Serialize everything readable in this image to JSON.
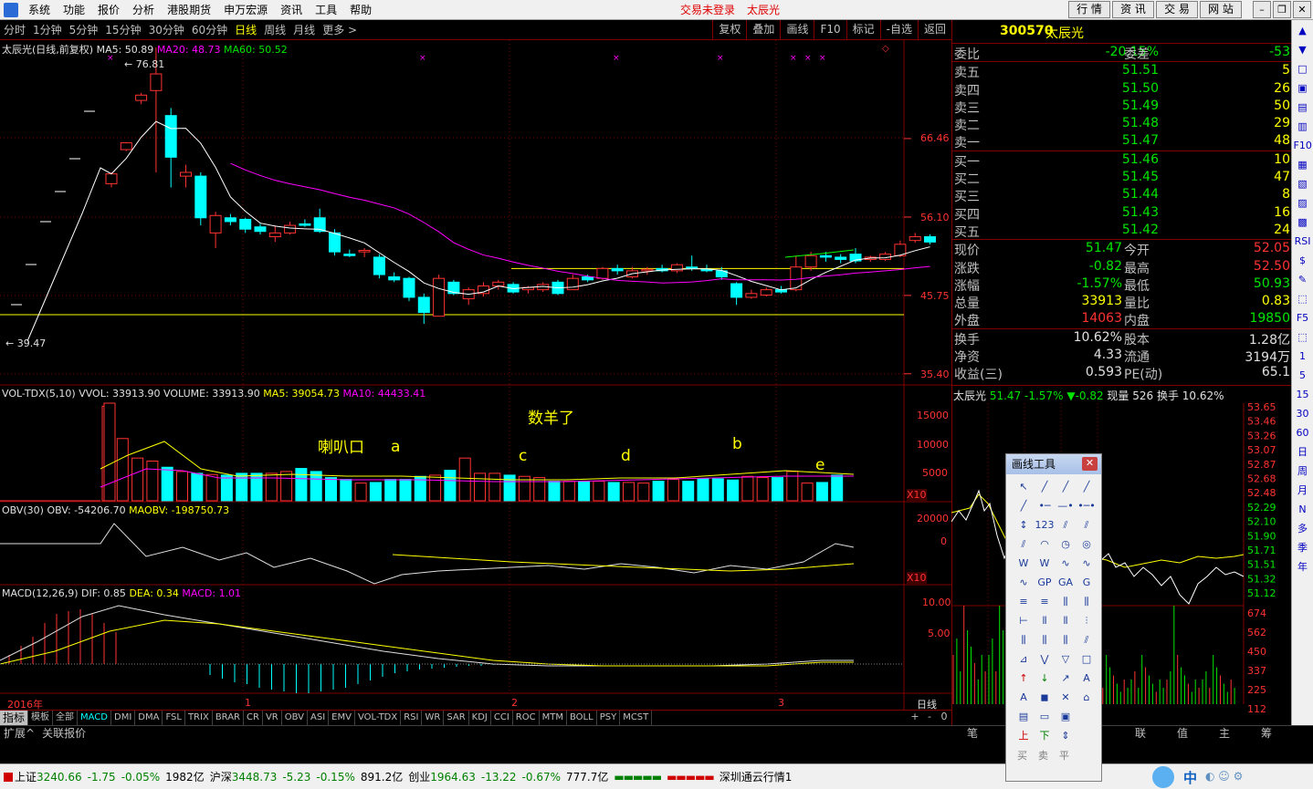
{
  "menu": {
    "items": [
      "系统",
      "功能",
      "报价",
      "分析",
      "港股期货",
      "申万宏源",
      "资讯",
      "工具",
      "帮助"
    ],
    "login_status": "交易未登录",
    "stock_name": "太辰光",
    "top_tabs": [
      "行 情",
      "资 讯",
      "交 易",
      "网 站"
    ]
  },
  "periods": {
    "items": [
      "分时",
      "1分钟",
      "5分钟",
      "15分钟",
      "30分钟",
      "60分钟",
      "日线",
      "周线",
      "月线",
      "更多 >"
    ],
    "active": "日线",
    "tools": [
      "复权",
      "叠加",
      "画线",
      "F10",
      "标记",
      "-自选",
      "返回"
    ]
  },
  "main_chart": {
    "title": "太辰光(日线,前复权)",
    "ma5_label": "MA5: 50.89",
    "ma20_label": "MA20: 48.73",
    "ma60_label": "MA60: 50.52",
    "high_mark": "76.81",
    "low_mark": "39.47",
    "axis_labels": [
      "66.46",
      "56.10",
      "45.75",
      "35.40"
    ]
  },
  "vol_chart": {
    "label_a": "VOL-TDX(5,10)",
    "label_b": "VVOL: 33913.90",
    "label_c": "VOLUME: 33913.90",
    "label_d": "MA5: 39054.73",
    "label_e": "MA10: 44433.41",
    "axis_labels": [
      "15000",
      "10000",
      "5000"
    ],
    "multiplier": "X10"
  },
  "obv_chart": {
    "label_a": "OBV(30)",
    "label_b": "OBV: -54206.70",
    "label_c": "MAOBV: -198750.73",
    "axis_labels": [
      "20000",
      "0"
    ],
    "multiplier": "X10"
  },
  "macd_chart": {
    "label_a": "MACD(12,26,9)",
    "label_b": "DIF: 0.85",
    "label_c": "DEA: 0.34",
    "label_d": "MACD: 1.01",
    "axis_labels": [
      "10.00",
      "5.00"
    ]
  },
  "date_axis": {
    "year": "2016年",
    "months": [
      "1",
      "2",
      "3"
    ],
    "period_label": "日线"
  },
  "annotations": {
    "trumpet": "喇叭口",
    "a": "a",
    "c": "c",
    "d": "d",
    "b": "b",
    "e": "e",
    "note": "数羊了"
  },
  "quote": {
    "code": "300570",
    "name": "太辰光",
    "weibi_label": "委比",
    "weibi": "-20.15%",
    "weicha_label": "委差",
    "weicha": "-53",
    "asks": [
      {
        "label": "卖五",
        "price": "51.51",
        "vol": "5"
      },
      {
        "label": "卖四",
        "price": "51.50",
        "vol": "26"
      },
      {
        "label": "卖三",
        "price": "51.49",
        "vol": "50"
      },
      {
        "label": "卖二",
        "price": "51.48",
        "vol": "29"
      },
      {
        "label": "卖一",
        "price": "51.47",
        "vol": "48"
      }
    ],
    "bids": [
      {
        "label": "买一",
        "price": "51.46",
        "vol": "10"
      },
      {
        "label": "买二",
        "price": "51.45",
        "vol": "47"
      },
      {
        "label": "买三",
        "price": "51.44",
        "vol": "8"
      },
      {
        "label": "买四",
        "price": "51.43",
        "vol": "16"
      },
      {
        "label": "买五",
        "price": "51.42",
        "vol": "24"
      }
    ],
    "stats1": [
      {
        "l1": "现价",
        "v1": "51.47",
        "l2": "今开",
        "v2": "52.05"
      },
      {
        "l1": "涨跌",
        "v1": "-0.82",
        "l2": "最高",
        "v2": "52.50"
      },
      {
        "l1": "涨幅",
        "v1": "-1.57%",
        "l2": "最低",
        "v2": "50.93"
      },
      {
        "l1": "总量",
        "v1": "33913",
        "l2": "量比",
        "v2": "0.83"
      },
      {
        "l1": "外盘",
        "v1": "14063",
        "l2": "内盘",
        "v2": "19850"
      }
    ],
    "stats2": [
      {
        "l1": "换手",
        "v1": "10.62%",
        "l2": "股本",
        "v2": "1.28亿"
      },
      {
        "l1": "净资",
        "v1": "4.33",
        "l2": "流通",
        "v2": "3194万"
      },
      {
        "l1": "收益(三)",
        "v1": "0.593",
        "l2": "PE(动)",
        "v2": "65.1"
      }
    ]
  },
  "mini": {
    "name": "太辰光",
    "price": "51.47",
    "pct": "-1.57%",
    "chg": "▼-0.82",
    "cur_vol": "现量 526",
    "turnover": "换手 10.62%",
    "left_axis": [
      "53.65",
      "53.46",
      "53.26",
      "53.07",
      "52.87",
      "52.68",
      "52.48",
      "52.29",
      "52.10",
      "51.90",
      "51.71",
      "51.51",
      "51.32",
      "51.12",
      "674",
      "562",
      "450",
      "337",
      "225",
      "112"
    ]
  },
  "indicator_tabs": [
    "指标",
    "模板",
    "全部",
    "MACD",
    "DMI",
    "DMA",
    "FSL",
    "TRIX",
    "BRAR",
    "CR",
    "VR",
    "OBV",
    "ASI",
    "EMV",
    "VOL-TDX",
    "RSI",
    "WR",
    "SAR",
    "KDJ",
    "CCI",
    "ROC",
    "MTM",
    "BOLL",
    "PSY",
    "MCST"
  ],
  "sub_tabs": [
    "扩展^",
    "关联报价"
  ],
  "right_tabs": [
    "笔",
    "",
    "",
    "",
    "联",
    "值",
    "主",
    "筹"
  ],
  "draw_tool": {
    "title": "画线工具",
    "bottom": [
      "买",
      "卖",
      "平"
    ]
  },
  "icon_strip": [
    "▲",
    "▼",
    "□",
    "▣",
    "▤",
    "▥",
    "F10",
    "▦",
    "▧",
    "▨",
    "▩",
    "RSI",
    "$",
    "✎",
    "⬚",
    "F5",
    "⬚",
    "1",
    "5",
    "15",
    "30",
    "60",
    "日",
    "周",
    "月",
    "N",
    "多",
    "季",
    "年"
  ],
  "status": {
    "sh_label": "上证",
    "sh_val": "3240.66",
    "sh_chg": "-1.75",
    "sh_pct": "-0.05%",
    "sh_amt": "1982亿",
    "hs_label": "沪深",
    "hs_val": "3448.73",
    "hs_chg": "-5.23",
    "hs_pct": "-0.15%",
    "hs_amt": "891.2亿",
    "cy_label": "创业",
    "cy_val": "1964.63",
    "cy_chg": "-13.22",
    "cy_pct": "-0.67%",
    "cy_amt": "777.7亿",
    "sz_tong": "深圳通云行情1",
    "cn": "中"
  },
  "colors": {
    "up": "#ff3232",
    "down": "#00ffff",
    "ma5": "#ffffff",
    "ma20": "#ff00ff",
    "ma60": "#00ff00",
    "yellow": "#ffff00",
    "border": "#800000"
  },
  "chart_data": {
    "type": "candlestick",
    "candles": [
      [
        60.5,
        62.0,
        60.0,
        61.8
      ],
      [
        65.0,
        66.0,
        64.8,
        65.9
      ],
      [
        71.5,
        72.5,
        71.0,
        72.2
      ],
      [
        72.8,
        78.5,
        62.0,
        75.0
      ],
      [
        69.5,
        70.5,
        60.0,
        64.0
      ],
      [
        61.5,
        63.0,
        60.0,
        62.0
      ],
      [
        61.5,
        62.0,
        55.0,
        56.0
      ],
      [
        54.0,
        56.8,
        52.0,
        56.3
      ],
      [
        56.0,
        56.5,
        55.0,
        55.5
      ],
      [
        55.8,
        56.0,
        54.0,
        54.5
      ],
      [
        54.8,
        55.2,
        53.8,
        54.2
      ],
      [
        53.5,
        55.0,
        52.8,
        54.0
      ],
      [
        54.0,
        55.5,
        53.8,
        55.0
      ],
      [
        55.2,
        55.8,
        54.8,
        55.0
      ],
      [
        56.0,
        57.2,
        54.0,
        54.2
      ],
      [
        54.0,
        54.5,
        51.0,
        51.5
      ],
      [
        51.2,
        51.8,
        50.8,
        51.0
      ],
      [
        51.5,
        52.0,
        50.8,
        51.7
      ],
      [
        50.8,
        51.2,
        48.0,
        48.5
      ],
      [
        48.2,
        48.8,
        47.5,
        47.8
      ],
      [
        48.0,
        48.2,
        45.0,
        45.5
      ],
      [
        45.5,
        46.0,
        42.0,
        43.5
      ],
      [
        43.0,
        48.5,
        43.0,
        48.0
      ],
      [
        47.5,
        47.8,
        45.8,
        46.0
      ],
      [
        45.3,
        46.8,
        44.5,
        46.5
      ],
      [
        46.0,
        47.5,
        45.6,
        47.0
      ],
      [
        47.0,
        47.8,
        46.5,
        47.5
      ],
      [
        47.2,
        47.5,
        46.0,
        46.2
      ],
      [
        46.5,
        47.0,
        46.0,
        46.8
      ],
      [
        46.5,
        47.5,
        46.2,
        47.2
      ],
      [
        47.5,
        47.8,
        45.8,
        46.0
      ],
      [
        46.5,
        48.5,
        46.5,
        48.0
      ],
      [
        48.2,
        48.5,
        47.5,
        47.8
      ],
      [
        48.0,
        49.5,
        47.8,
        49.3
      ],
      [
        49.3,
        49.8,
        48.5,
        49.0
      ],
      [
        48.2,
        49.5,
        48.0,
        49.0
      ],
      [
        49.0,
        49.5,
        48.5,
        49.2
      ],
      [
        49.3,
        49.8,
        48.8,
        49.0
      ],
      [
        49.0,
        50.0,
        48.7,
        49.8
      ],
      [
        49.5,
        51.0,
        49.0,
        49.3
      ],
      [
        49.2,
        49.8,
        48.8,
        49.0
      ],
      [
        49.0,
        49.5,
        47.8,
        48.2
      ],
      [
        47.3,
        47.5,
        44.5,
        45.5
      ],
      [
        45.5,
        46.5,
        45.3,
        46.0
      ],
      [
        45.8,
        46.8,
        45.6,
        46.5
      ],
      [
        46.5,
        47.0,
        46.0,
        46.2
      ],
      [
        46.5,
        51.0,
        46.3,
        49.5
      ],
      [
        49.5,
        51.5,
        49.0,
        51.0
      ],
      [
        51.0,
        51.5,
        50.2,
        50.8
      ],
      [
        50.8,
        51.2,
        50.0,
        50.5
      ],
      [
        51.2,
        52.0,
        50.0,
        50.3
      ],
      [
        50.5,
        51.0,
        50.2,
        50.8
      ],
      [
        50.5,
        51.5,
        50.3,
        51.2
      ],
      [
        51.0,
        53.0,
        50.8,
        52.5
      ],
      [
        53.0,
        54.0,
        52.7,
        53.5
      ],
      [
        53.5,
        53.8,
        52.5,
        52.8
      ]
    ],
    "volume": [
      500,
      500,
      500,
      500,
      500,
      500,
      500,
      15500,
      10200,
      7000,
      6500,
      5500,
      4800,
      4500,
      4300,
      4200,
      4500,
      4500,
      4500,
      4800,
      5300,
      4800,
      3800,
      3500,
      2900,
      3000,
      3500,
      3500,
      4000,
      4200,
      5000,
      7000,
      4500,
      4500,
      4200,
      4000,
      3800,
      3200,
      3200,
      3200,
      3200,
      3000,
      3000,
      2900,
      3200,
      3500,
      3200,
      3600,
      3600,
      3400,
      4000,
      3800,
      3800,
      4800,
      2900,
      3000,
      4200,
      3800,
      3500,
      4800,
      3800,
      4200,
      3800,
      3500,
      3500,
      3500,
      3500,
      3800,
      3800,
      3800,
      3800,
      4000,
      5000,
      4000,
      3800
    ],
    "ma5_y": [],
    "ma20_y": []
  }
}
